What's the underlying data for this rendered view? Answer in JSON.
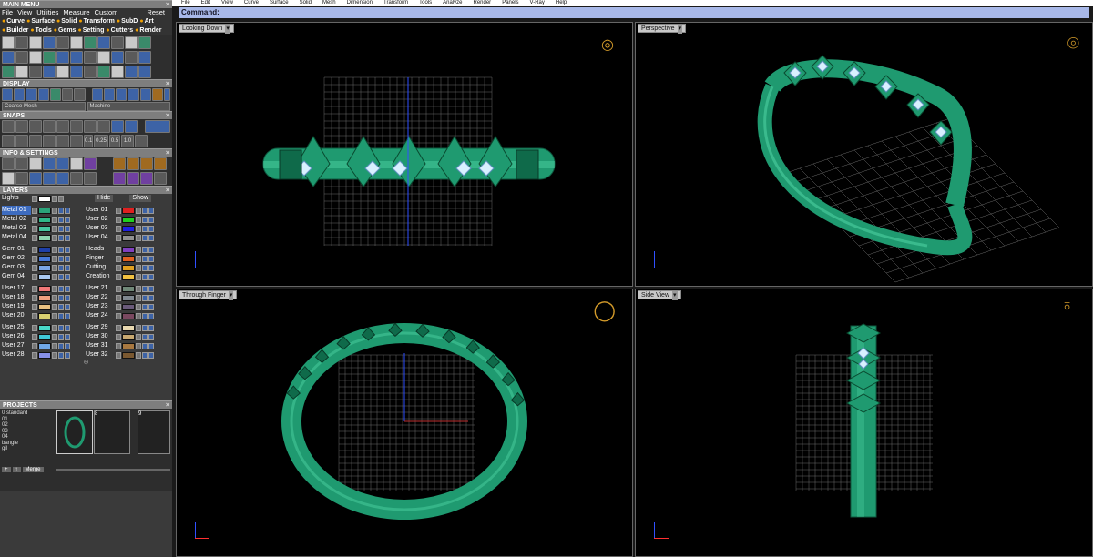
{
  "app": {
    "main_menu_title": "MAIN MENU",
    "menu": [
      "File",
      "View",
      "Utilities",
      "Measure",
      "Custom"
    ],
    "reset": "Reset",
    "toolbar_tabs_row1": [
      "Curve",
      "Surface",
      "Solid",
      "Transform",
      "SubD",
      "Art"
    ],
    "toolbar_tabs_row2": [
      "Builder",
      "Tools",
      "Gems",
      "Setting",
      "Cutters",
      "Render"
    ]
  },
  "sections": {
    "display": "DISPLAY",
    "snaps": "SNAPS",
    "info": "INFO & SETTINGS",
    "layers": "LAYERS",
    "projects": "PROJECTS"
  },
  "display": {
    "mesh_option": "Coarse Mesh",
    "machine_option": "Machine"
  },
  "snaps": {
    "values": [
      "0.1",
      "0.25",
      "0.5",
      "1.0"
    ]
  },
  "layers": {
    "lights_label": "Lights",
    "hide_label": "Hide",
    "show_label": "Show",
    "left": [
      {
        "name": "Metal 01",
        "color": "#2aa37a",
        "hl": true
      },
      {
        "name": "Metal 02",
        "color": "#2fb88a"
      },
      {
        "name": "Metal 03",
        "color": "#46c6a0"
      },
      {
        "name": "Metal 04",
        "color": "#8ed4b0"
      },
      {
        "name": "Gem 01",
        "color": "#1e3fa8"
      },
      {
        "name": "Gem 02",
        "color": "#4678d8"
      },
      {
        "name": "Gem 03",
        "color": "#7aa6e8"
      },
      {
        "name": "Gem 04",
        "color": "#a8c8f0"
      },
      {
        "name": "User 17",
        "color": "#f07878"
      },
      {
        "name": "User 18",
        "color": "#f0a080"
      },
      {
        "name": "User 19",
        "color": "#e8c080"
      },
      {
        "name": "User 20",
        "color": "#d8d070"
      },
      {
        "name": "User 25",
        "color": "#48d8c8"
      },
      {
        "name": "User 26",
        "color": "#40c8d8"
      },
      {
        "name": "User 27",
        "color": "#70a8e8"
      },
      {
        "name": "User 28",
        "color": "#8890e8"
      }
    ],
    "right": [
      {
        "name": "User 01",
        "color": "#e02020"
      },
      {
        "name": "User 02",
        "color": "#20d020"
      },
      {
        "name": "User 03",
        "color": "#2020e0"
      },
      {
        "name": "User 04",
        "color": "#909090"
      },
      {
        "name": "Heads",
        "color": "#8040c0"
      },
      {
        "name": "Finger",
        "color": "#e06020"
      },
      {
        "name": "Cutting",
        "color": "#e0a020"
      },
      {
        "name": "Creation",
        "color": "#f0c040"
      },
      {
        "name": "User 21",
        "color": "#708878"
      },
      {
        "name": "User 22",
        "color": "#808890"
      },
      {
        "name": "User 23",
        "color": "#6a5a7a"
      },
      {
        "name": "User 24",
        "color": "#7a4860"
      },
      {
        "name": "User 29",
        "color": "#e8d8b0"
      },
      {
        "name": "User 30",
        "color": "#c8a870"
      },
      {
        "name": "User 31",
        "color": "#a87840"
      },
      {
        "name": "User 32",
        "color": "#7a5830"
      }
    ]
  },
  "projects": {
    "list": [
      "0 standard",
      "01",
      "02",
      "03",
      "04",
      "bangle",
      "gil"
    ],
    "cell_numbers": [
      "8",
      "9"
    ],
    "buttons": [
      "+",
      "↑",
      "Merge"
    ]
  },
  "top_menu": [
    "File",
    "Edit",
    "View",
    "Curve",
    "Surface",
    "Solid",
    "Mesh",
    "Dimension",
    "Transform",
    "Tools",
    "Analyze",
    "Render",
    "Panels",
    "V-Ray",
    "Help"
  ],
  "command_label": "Command:",
  "viewports": {
    "top": "Looking Down",
    "perspective": "Perspective",
    "front": "Through Finger",
    "right": "Side View"
  },
  "colors": {
    "metal": "#1f9a70",
    "metal_dark": "#0f6a4a",
    "metal_light": "#4cd0a0",
    "grid": "#6a6a6a",
    "axis_x": "#c03030",
    "axis_y": "#3050ff"
  }
}
